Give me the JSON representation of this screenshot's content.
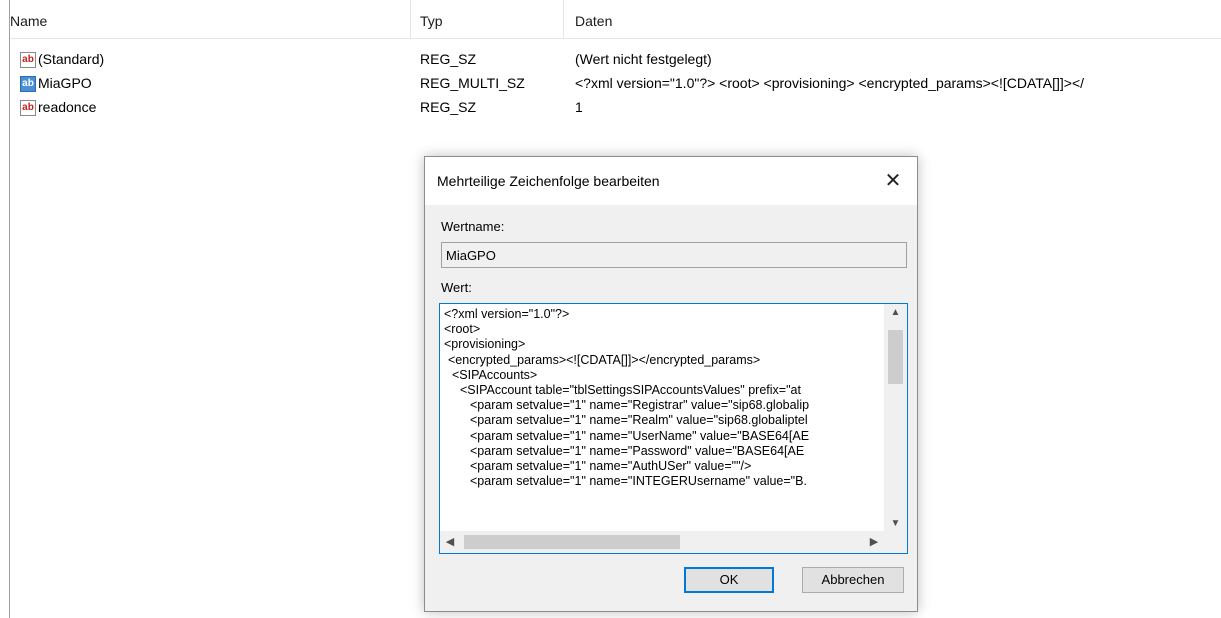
{
  "list": {
    "columns": [
      "Name",
      "Typ",
      "Daten"
    ],
    "rows": [
      {
        "icon": "string-value-icon",
        "name": "(Standard)",
        "type": "REG_SZ",
        "data": "(Wert nicht festgelegt)"
      },
      {
        "icon": "multi-string-value-icon",
        "name": "MiaGPO",
        "type": "REG_MULTI_SZ",
        "data": "<?xml version=\"1.0\"?> <root> <provisioning>   <encrypted_params><![CDATA[]]></"
      },
      {
        "icon": "string-value-icon",
        "name": "readonce",
        "type": "REG_SZ",
        "data": "1"
      }
    ],
    "icon_glyph": "ab"
  },
  "dialog": {
    "title": "Mehrteilige Zeichenfolge bearbeiten",
    "close_glyph": "✕",
    "value_name_label": "Wertname:",
    "value_name": "MiaGPO",
    "value_label": "Wert:",
    "value_lines": [
      "<?xml version=\"1.0\"?>",
      "<root>",
      "<provisioning>",
      "  <encrypted_params><![CDATA[]]></encrypted_params>",
      "  <SIPAccounts>",
      "    <SIPAccount table=\"tblSettingsSIPAccountsValues\" prefix=\"at",
      "      <param setvalue=\"1\" name=\"Registrar\" value=\"sip68.globalip",
      "      <param setvalue=\"1\" name=\"Realm\" value=\"sip68.globaliptel",
      "      <param setvalue=\"1\" name=\"UserName\" value=\"BASE64[AE",
      "      <param setvalue=\"1\" name=\"Password\" value=\"BASE64[AE",
      "      <param setvalue=\"1\" name=\"AuthUSer\" value=\"\"/>",
      "      <param setvalue=\"1\" name=\"INTEGERUsername\" value=\"B."
    ],
    "ok_label": "OK",
    "cancel_label": "Abbrechen"
  }
}
